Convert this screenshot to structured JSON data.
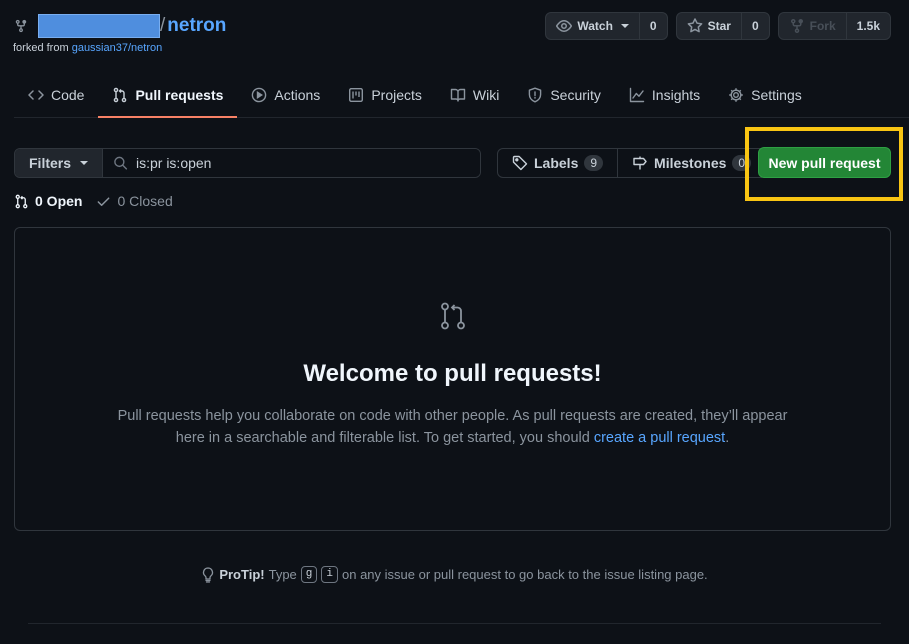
{
  "repo": {
    "name": "netron",
    "separator": "/",
    "forked_from_prefix": "forked from",
    "forked_from_link": "gaussian37/netron"
  },
  "actions": {
    "watch_label": "Watch",
    "watch_count": "0",
    "star_label": "Star",
    "star_count": "0",
    "fork_label": "Fork",
    "fork_count": "1.5k"
  },
  "tabs": [
    {
      "label": "Code",
      "icon": "code-icon"
    },
    {
      "label": "Pull requests",
      "icon": "pull-request-icon",
      "active": true
    },
    {
      "label": "Actions",
      "icon": "play-icon"
    },
    {
      "label": "Projects",
      "icon": "table-icon"
    },
    {
      "label": "Wiki",
      "icon": "book-icon"
    },
    {
      "label": "Security",
      "icon": "shield-icon"
    },
    {
      "label": "Insights",
      "icon": "graph-icon"
    },
    {
      "label": "Settings",
      "icon": "gear-icon"
    }
  ],
  "toolbar": {
    "filters_label": "Filters",
    "search_value": "is:pr is:open",
    "labels_label": "Labels",
    "labels_count": "9",
    "milestones_label": "Milestones",
    "milestones_count": "0",
    "new_pr_label": "New pull request"
  },
  "states": {
    "open_label": "0 Open",
    "closed_label": "0 Closed"
  },
  "blankslate": {
    "title": "Welcome to pull requests!",
    "text_before": "Pull requests help you collaborate on code with other people. As pull requests are created, they’ll appear here in a searchable and filterable list. To get started, you should",
    "link": "create a pull request",
    "text_after": "."
  },
  "protip": {
    "label": "ProTip!",
    "before": "Type",
    "key1": "g",
    "key2": "i",
    "after": "on any issue or pull request to go back to the issue listing page."
  },
  "colors": {
    "background": "#0d1117",
    "accent_link": "#58a6ff",
    "primary_button": "#238636",
    "highlight": "#f9c513",
    "active_tab_underline": "#f78166"
  }
}
